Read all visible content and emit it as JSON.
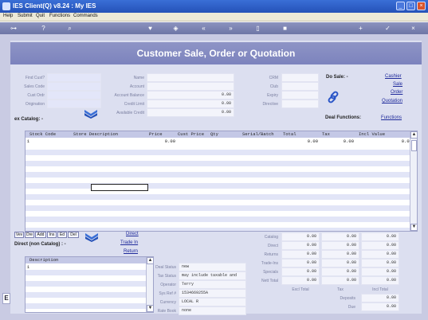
{
  "window": {
    "title": "IES Client(Q) v8.24 : My IES"
  },
  "menu": [
    "Help",
    "Submit",
    "Quit",
    "Functions",
    "Commands"
  ],
  "form": {
    "header": "Customer Sale, Order or Quotation",
    "left_labels": [
      "Find Cust?",
      "Sales Code",
      "Cust Ordr",
      "Origination"
    ],
    "mid_labels": [
      "Name",
      "Account",
      "Account Balance",
      "Credit Limit",
      "Available Credit"
    ],
    "mid_values": [
      "",
      "",
      "0.00",
      "0.00",
      "0.00"
    ],
    "right_labels": [
      "CRM",
      "Club",
      "Expiry",
      "Directive"
    ],
    "do_sale": "Do Sale: -",
    "do_sale_links": [
      "Cashier",
      "Sale",
      "Order",
      "Quotation"
    ],
    "catalog_label": "ex Catalog: -",
    "deal_functions_label": "Deal Functions:",
    "functions_link": "Functions"
  },
  "items_grid": {
    "columns": [
      "Stock Code",
      "Store Description",
      "Price",
      "Cust Price",
      "Qty",
      "Serial/Batch",
      "Total",
      "Tax",
      "Incl Value"
    ],
    "rows": [
      {
        "num": "1",
        "price": "0.00",
        "total": "0.00",
        "tax": "0.00",
        "incl": "0.00"
      }
    ]
  },
  "tabs": [
    "Vev",
    "Dre",
    "Add",
    "Ins",
    "Ed",
    "Del"
  ],
  "direct": {
    "label": "Direct (non Catalog) : -",
    "links": [
      "Direct",
      "Trade In",
      "Return"
    ],
    "desc_header": "Description",
    "row_num": "1"
  },
  "deal": {
    "labels": [
      "Deal Status",
      "Tax Status",
      "Operator",
      "Sys Ref #",
      "Currency",
      "Rate Book"
    ],
    "values": [
      "new",
      "may include taxable and",
      "Terry",
      "1534669255A",
      "LOCAL R",
      "none"
    ]
  },
  "totals": {
    "row_labels": [
      "Catalog",
      "Direct",
      "Returns",
      "Trade-Ins",
      "Specials",
      "Nett Total"
    ],
    "values": [
      [
        "0.00",
        "0.00",
        "0.00"
      ],
      [
        "0.00",
        "0.00",
        "0.00"
      ],
      [
        "0.00",
        "0.00",
        "0.00"
      ],
      [
        "0.00",
        "0.00",
        "0.00"
      ],
      [
        "0.00",
        "0.00",
        "0.00"
      ],
      [
        "0.00",
        "0.00",
        "0.00"
      ]
    ],
    "col_labels": [
      "Excl Total",
      "Tax",
      "Incl Total"
    ],
    "deposits_label": "Deposits",
    "deposits_value": "0.00",
    "due_label": "Due",
    "due_value": "0.00"
  },
  "edge_letter": "E"
}
